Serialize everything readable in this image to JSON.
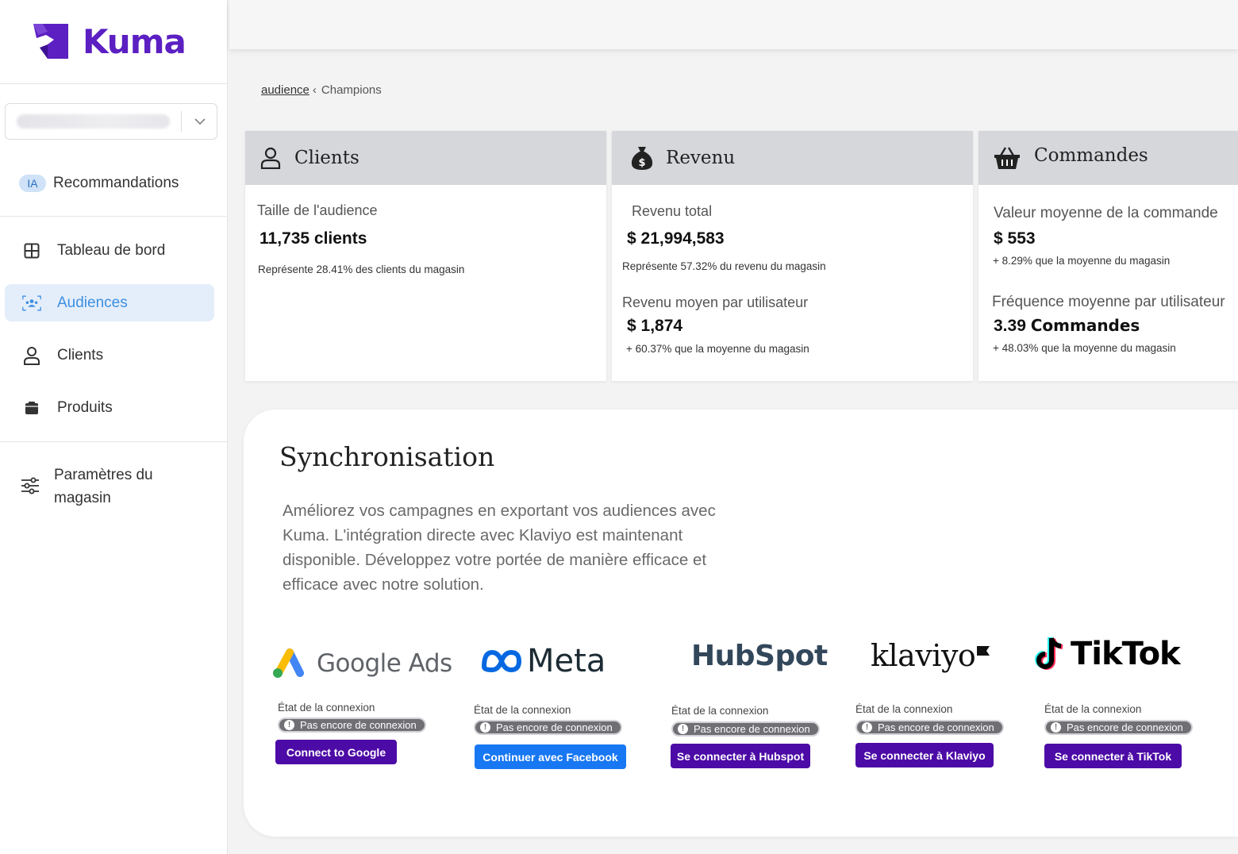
{
  "app": {
    "name": "Kuma",
    "brand_color": "#5b1fc2"
  },
  "sidebar": {
    "recommendations": {
      "badge": "IA",
      "label": "Recommandations"
    },
    "items": [
      {
        "label": "Tableau de bord",
        "icon": "dashboard-icon"
      },
      {
        "label": "Audiences",
        "icon": "audience-icon",
        "active": true
      },
      {
        "label": "Clients",
        "icon": "user-icon"
      },
      {
        "label": "Produits",
        "icon": "box-icon"
      }
    ],
    "settings": {
      "label": "Paramètres du magasin",
      "icon": "sliders-icon"
    }
  },
  "breadcrumb": {
    "parent": "audience",
    "separator": "‹",
    "current": "Champions"
  },
  "cards": {
    "clients": {
      "title": "Clients",
      "audience_label": "Taille de l'audience",
      "audience_value": "11,735 clients",
      "audience_note": "Représente 28.41% des clients du magasin"
    },
    "revenue": {
      "title": "Revenu",
      "total_label": "Revenu total",
      "total_value": "$ 21,994,583",
      "total_note": "Représente 57.32% du revenu du magasin",
      "avg_label": "Revenu moyen par utilisateur",
      "avg_value": "$ 1,874",
      "avg_note_pct": "+ 60.37%",
      "avg_note": "que la moyenne du magasin"
    },
    "orders": {
      "title": "Commandes",
      "aov_label": "Valeur moyenne de la commande",
      "aov_value": "$ 553",
      "aov_note_pct": "+ 8.29%",
      "aov_note": "que la moyenne du magasin",
      "freq_label": "Fréquence moyenne par utilisateur",
      "freq_value": "3.39",
      "freq_unit": "Commandes",
      "freq_note_pct": "+ 48.03%",
      "freq_note": "que la moyenne du magasin"
    }
  },
  "sync": {
    "title": "Synchronisation",
    "description": "Améliorez vos campagnes en exportant vos audiences avec Kuma. L'intégration directe avec Klaviyo est maintenant disponible. Développez votre portée de manière efficace et efficace avec notre solution.",
    "state_label": "État de la connexion",
    "state_value": "Pas encore de connexion",
    "integrations": [
      {
        "name": "Google Ads",
        "button": "Connect to Google"
      },
      {
        "name": "Meta",
        "button": "Continuer avec Facebook"
      },
      {
        "name": "HubSpot",
        "button": "Se connecter à Hubspot"
      },
      {
        "name": "klaviyo",
        "button": "Se connecter à Klaviyo"
      },
      {
        "name": "TikTok",
        "button": "Se connecter à TikTok"
      }
    ]
  }
}
